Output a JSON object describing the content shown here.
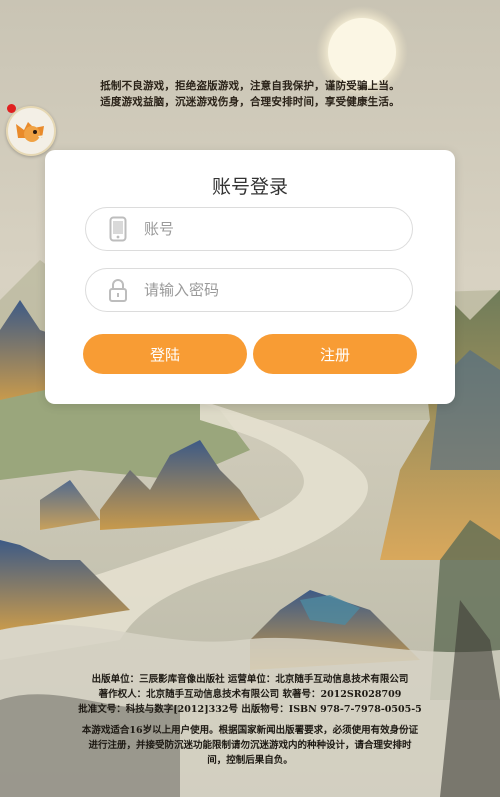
{
  "health_notice": {
    "line1": "抵制不良游戏，拒绝盗版游戏，注意自我保护，谨防受骗上当。",
    "line2": "适度游戏益脑，沉迷游戏伤身，合理安排时间，享受健康生活。"
  },
  "avatar": {
    "icon": "fox-mascot-icon"
  },
  "login": {
    "title": "账号登录",
    "account_placeholder": "账号",
    "account_value": "",
    "password_placeholder": "请输入密码",
    "password_value": "",
    "login_label": "登陆",
    "register_label": "注册",
    "button_color": "#f89c34"
  },
  "footer": {
    "line1": "出版单位：三辰影库音像出版社    运营单位：北京随手互动信息技术有限公司",
    "line2": "著作权人：北京随手互动信息技术有限公司    软著号：2012SR028709",
    "line3": "批准文号：科技与数字[2012]332号    出版物号：ISBN 978-7-7978-0505-5",
    "notice": "本游戏适合16岁以上用户使用。根据国家新闻出版署要求，必须使用有效身份证进行注册，并接受防沉迷功能限制请勿沉迷游戏内的种种设计，请合理安排时间，控制后果自负。"
  }
}
